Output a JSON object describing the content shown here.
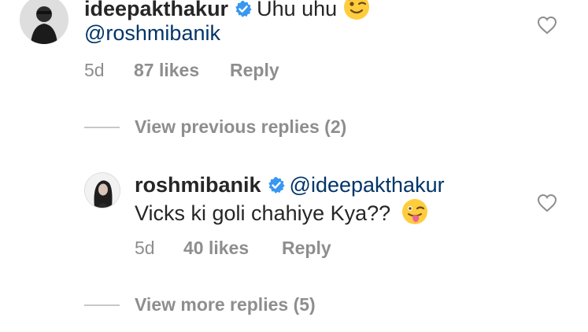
{
  "comment1": {
    "username": "ideepakthakur",
    "text": "Uhu uhu",
    "emoji": "winking-face",
    "mention": "@roshmibanik",
    "age": "5d",
    "likes": "87 likes",
    "reply": "Reply"
  },
  "toggle1": {
    "label": "View previous replies (2)"
  },
  "comment2": {
    "username": "roshmibanik",
    "mention": "@ideepakthakur",
    "text": "Vicks ki goli chahiye Kya??",
    "emoji": "winking-face-with-tongue",
    "age": "5d",
    "likes": "40 likes",
    "reply": "Reply"
  },
  "toggle2": {
    "label": "View more replies (5)"
  },
  "colors": {
    "verified": "#3897f0",
    "mention": "#003569",
    "meta": "#8e8e8e",
    "emoji_face": "#ffcc3e"
  }
}
